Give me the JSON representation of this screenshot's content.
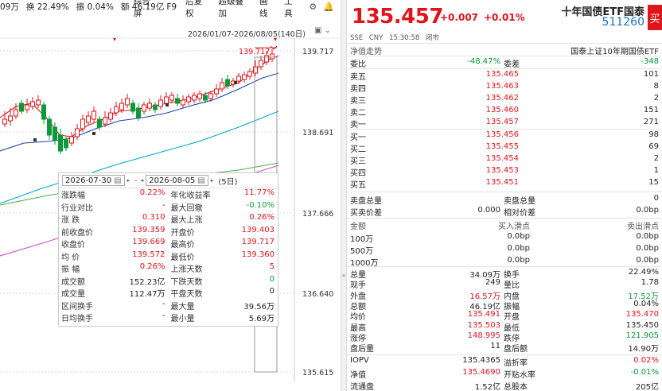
{
  "topstats": {
    "vol": "09万",
    "turnover": "换 22.49%",
    "amplitude": "振 0.04%",
    "amount": "额 46.19亿"
  },
  "menu": [
    "综合屏",
    "F9",
    "后复权",
    "超级叠加",
    "画线",
    "工具"
  ],
  "menu_icons": [
    "gear-icon",
    "bell-icon"
  ],
  "chart_range": "2026/01/07-2026/08/05(140日)",
  "chart": {
    "y_labels": [
      "139.717",
      "138.691",
      "137.666",
      "136.640",
      "135.615"
    ],
    "marker_price": "139.717",
    "candle_up_color": "#e0141b",
    "candle_down_color": "#0a9a38",
    "ma_colors": [
      "#e0141b",
      "#1e3fb0",
      "#00a6d6",
      "#4caf50",
      "#d04ad0"
    ]
  },
  "interval": {
    "start_date": "2026-07-30",
    "end_date": "2026-08-05",
    "days": "(5日)",
    "rows": [
      [
        {
          "l": "涨跌幅",
          "v": "0.22%",
          "c": "red"
        },
        {
          "l": "年化收益率",
          "v": "11.77%",
          "c": "red"
        }
      ],
      [
        {
          "l": "行业对比",
          "v": "-",
          "c": "dark"
        },
        {
          "l": "最大回撤",
          "v": "-0.10%",
          "c": "green"
        }
      ],
      [
        {
          "l": "涨  跌",
          "v": "0.310",
          "c": "red"
        },
        {
          "l": "最大上涨",
          "v": "0.26%",
          "c": "red"
        }
      ],
      [
        {
          "l": "前收盘价",
          "v": "139.359",
          "c": "red"
        },
        {
          "l": "开盘价",
          "v": "139.403",
          "c": "red"
        }
      ],
      [
        {
          "l": "收盘价",
          "v": "139.669",
          "c": "red"
        },
        {
          "l": "最高价",
          "v": "139.717",
          "c": "red"
        }
      ],
      [
        {
          "l": "均  价",
          "v": "139.572",
          "c": "red"
        },
        {
          "l": "最低价",
          "v": "139.360",
          "c": "red"
        }
      ],
      [
        {
          "l": "振  幅",
          "v": "0.26%",
          "c": "red"
        },
        {
          "l": "上涨天数",
          "v": "5",
          "c": "red"
        }
      ],
      [
        {
          "l": "成交额",
          "v": "152.23亿",
          "c": "dark"
        },
        {
          "l": "下跌天数",
          "v": "0",
          "c": "green"
        }
      ],
      [
        {
          "l": "成交量",
          "v": "112.47万",
          "c": "dark"
        },
        {
          "l": "平盘天数",
          "v": "0",
          "c": "dark"
        }
      ],
      [
        {
          "l": "区间换手",
          "v": "-",
          "c": "dark"
        },
        {
          "l": "最大量",
          "v": "39.56万",
          "c": "dark"
        }
      ],
      [
        {
          "l": "日均换手",
          "v": "-",
          "c": "dark"
        },
        {
          "l": "最小量",
          "v": "5.69万",
          "c": "dark"
        }
      ]
    ]
  },
  "quote": {
    "price": "135.457",
    "change": "+0.007",
    "change_pct": "+0.01%",
    "name": "十年国债ETF国泰",
    "code": "511260",
    "buy_button": "买",
    "meta": [
      "SSE",
      "CNY",
      "15:30:58",
      "闭市"
    ],
    "nav_label": "净值走势",
    "index_label": "国泰上证10年期国债ETF",
    "weibi": {
      "l1": "委比",
      "v1": "-48.47%",
      "l2": "委差",
      "v2": "-348"
    },
    "asks": [
      {
        "l": "卖五",
        "p": "135.465",
        "q": "101"
      },
      {
        "l": "卖四",
        "p": "135.463",
        "q": "8"
      },
      {
        "l": "卖三",
        "p": "135.462",
        "q": "2"
      },
      {
        "l": "卖二",
        "p": "135.460",
        "q": "151"
      },
      {
        "l": "卖一",
        "p": "135.457",
        "q": "271"
      }
    ],
    "bids": [
      {
        "l": "买一",
        "p": "135.456",
        "q": "98"
      },
      {
        "l": "买二",
        "p": "135.455",
        "q": "69"
      },
      {
        "l": "买三",
        "p": "135.454",
        "q": "2"
      },
      {
        "l": "买四",
        "p": "135.453",
        "q": "1"
      },
      {
        "l": "买五",
        "p": "135.451",
        "q": "15"
      }
    ],
    "orders": [
      {
        "l1": "卖盘总量",
        "v1": "",
        "l2": "卖盘总量",
        "v2": "0"
      },
      {
        "l1": "买卖价差",
        "v1": "0.000",
        "l2": "相对价差",
        "v2": "0.0bp"
      }
    ],
    "depth_head": {
      "c1": "金额",
      "c2": "买入滑点",
      "c3": "卖出滑点"
    },
    "depth": [
      {
        "a": "100万",
        "b": "0.0bp",
        "s": "0.0bp"
      },
      {
        "a": "500万",
        "b": "0.0bp",
        "s": "0.0bp"
      },
      {
        "a": "1000万",
        "b": "0.0bp",
        "s": "0.0bp"
      }
    ],
    "stats": [
      {
        "l1": "总量",
        "v1": "34.09万",
        "c1": "dark",
        "l2": "换手",
        "v2": "22.49%",
        "c2": "dark"
      },
      {
        "l1": "现手",
        "v1": "249",
        "c1": "dark",
        "l2": "量比",
        "v2": "1.78",
        "c2": "dark"
      },
      {
        "l1": "外盘",
        "v1": "16.57万",
        "c1": "red",
        "l2": "内盘",
        "v2": "17.52万",
        "c2": "green"
      },
      {
        "l1": "总额",
        "v1": "46.19亿",
        "c1": "dark",
        "l2": "振幅",
        "v2": "0.04%",
        "c2": "dark"
      },
      {
        "l1": "均价",
        "v1": "135.491",
        "c1": "red",
        "l2": "开盘",
        "v2": "135.470",
        "c2": "red"
      },
      {
        "l1": "最高",
        "v1": "135.503",
        "c1": "red",
        "l2": "最低",
        "v2": "135.450",
        "c2": "dark"
      },
      {
        "l1": "涨停",
        "v1": "148.995",
        "c1": "red",
        "l2": "跌停",
        "v2": "121.905",
        "c2": "green"
      },
      {
        "l1": "盘后量",
        "v1": "11",
        "c1": "dark",
        "l2": "盘后额",
        "v2": "14.90万",
        "c2": "dark"
      }
    ],
    "extra": [
      {
        "l1": "IOPV",
        "v1": "135.4365",
        "c1": "dark",
        "l2": "溢折率",
        "v2": "0.02%",
        "c2": "red"
      },
      {
        "l1": "净值",
        "v1": "135.4690",
        "c1": "red",
        "l2": "开贴水率",
        "v2": "-0.01%",
        "c2": "green"
      },
      {
        "l1": "流通盘",
        "v1": "1.52亿",
        "c1": "dark",
        "l2": "总股本",
        "v2": "205亿",
        "c2": "dark"
      }
    ]
  }
}
